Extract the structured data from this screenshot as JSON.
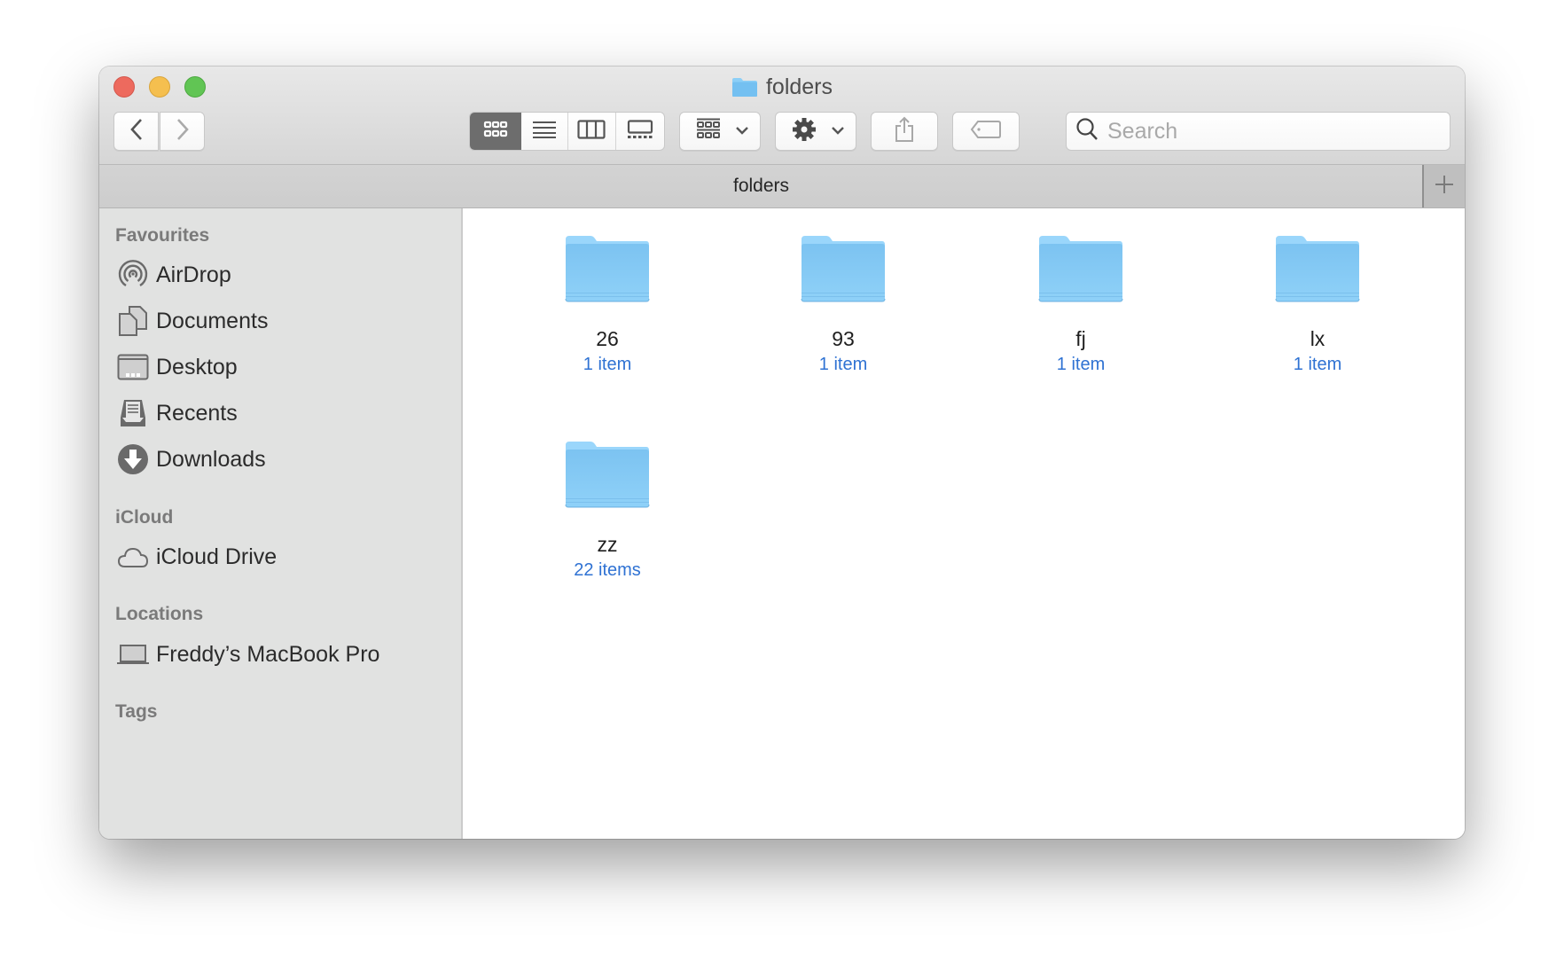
{
  "window": {
    "title": "folders",
    "traffic_lights": [
      "close",
      "minimize",
      "zoom"
    ]
  },
  "toolbar": {
    "back_icon": "chevron-left-icon",
    "forward_icon": "chevron-right-icon",
    "view_modes": [
      {
        "name": "icon-view",
        "active": true
      },
      {
        "name": "list-view",
        "active": false
      },
      {
        "name": "column-view",
        "active": false
      },
      {
        "name": "gallery-view",
        "active": false
      }
    ],
    "group_icon": "group-by-icon",
    "action_icon": "gear-icon",
    "share_icon": "share-icon",
    "tag_icon": "tag-icon",
    "search_placeholder": "Search",
    "search_value": ""
  },
  "tabbar": {
    "tab_label": "folders",
    "add_tab_icon": "plus-icon"
  },
  "sidebar": {
    "sections": [
      {
        "heading": "Favourites",
        "items": [
          {
            "label": "AirDrop",
            "icon": "airdrop-icon"
          },
          {
            "label": "Documents",
            "icon": "documents-icon"
          },
          {
            "label": "Desktop",
            "icon": "desktop-icon"
          },
          {
            "label": "Recents",
            "icon": "recents-icon"
          },
          {
            "label": "Downloads",
            "icon": "downloads-icon"
          }
        ]
      },
      {
        "heading": "iCloud",
        "items": [
          {
            "label": "iCloud Drive",
            "icon": "cloud-icon"
          }
        ]
      },
      {
        "heading": "Locations",
        "items": [
          {
            "label": "Freddy’s MacBook Pro",
            "icon": "laptop-icon"
          }
        ]
      },
      {
        "heading": "Tags",
        "items": []
      }
    ]
  },
  "content": {
    "items": [
      {
        "name": "26",
        "count": "1 item"
      },
      {
        "name": "93",
        "count": "1 item"
      },
      {
        "name": "fj",
        "count": "1 item"
      },
      {
        "name": "lx",
        "count": "1 item"
      },
      {
        "name": "zz",
        "count": "22 items"
      }
    ]
  },
  "colors": {
    "folder_blue": "#7ec6f3",
    "count_text": "#2f72d3",
    "active_segment": "#6d6d6d"
  }
}
